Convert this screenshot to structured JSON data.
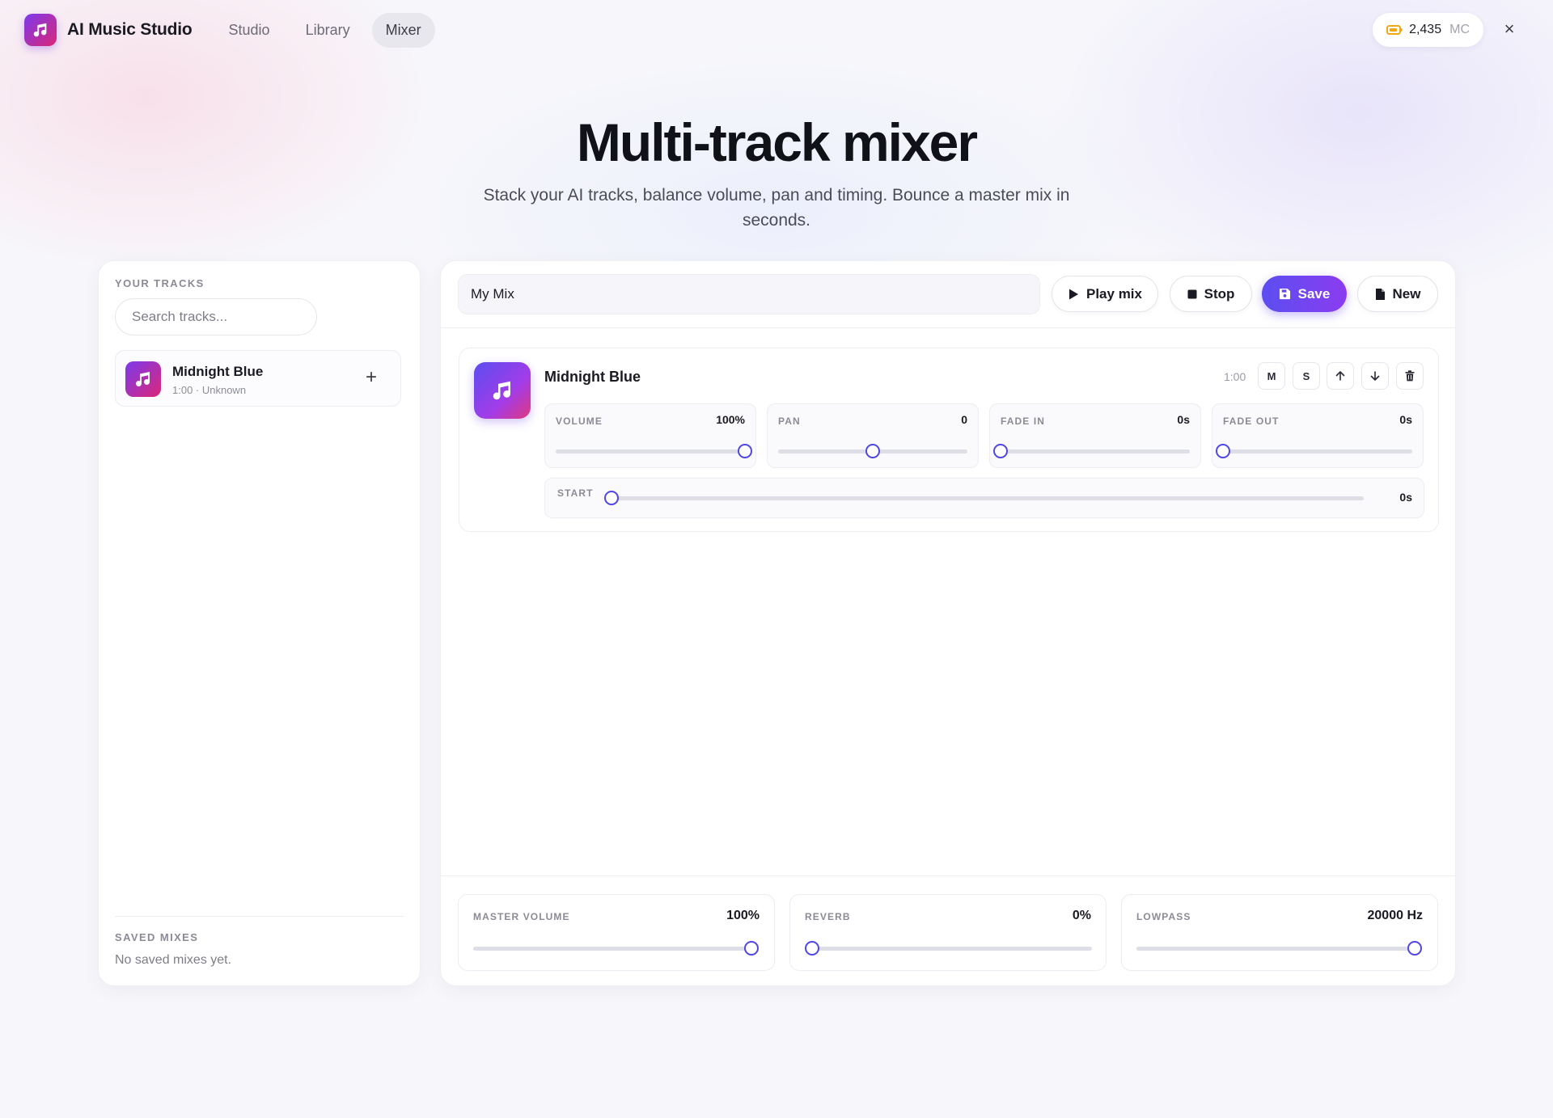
{
  "app": {
    "name": "AI Music Studio"
  },
  "nav": {
    "tabs": [
      "Studio",
      "Library",
      "Mixer"
    ],
    "active": "Mixer"
  },
  "credits": {
    "amount": "2,435",
    "unit": "MC"
  },
  "hero": {
    "title": "Multi-track mixer",
    "subtitle": "Stack your AI tracks, balance volume, pan and timing. Bounce a master mix in seconds."
  },
  "library": {
    "label": "YOUR TRACKS",
    "search_placeholder": "Search tracks...",
    "items": [
      {
        "name": "Midnight Blue",
        "meta": "1:00 · Unknown"
      }
    ],
    "saved_label": "SAVED MIXES",
    "saved_empty": "No saved mixes yet."
  },
  "toolbar": {
    "mix_name": "My Mix",
    "play_label": "Play mix",
    "stop_label": "Stop",
    "save_label": "Save",
    "new_label": "New"
  },
  "track": {
    "name": "Midnight Blue",
    "duration": "1:00",
    "mute_label": "M",
    "solo_label": "S",
    "controls": {
      "volume": {
        "label": "VOLUME",
        "value": "100%",
        "level": 1.0
      },
      "pan": {
        "label": "PAN",
        "value": "0",
        "level": 0.5
      },
      "fade_in": {
        "label": "FADE IN",
        "value": "0s",
        "level": 0.0
      },
      "fade_out": {
        "label": "FADE OUT",
        "value": "0s",
        "level": 0.0
      },
      "start": {
        "label": "START",
        "value": "0s",
        "level": 0.0
      }
    }
  },
  "master": {
    "volume": {
      "label": "MASTER VOLUME",
      "value": "100%",
      "level": 1.0
    },
    "reverb": {
      "label": "REVERB",
      "value": "0%",
      "level": 0.0
    },
    "lowpass": {
      "label": "LOWPASS",
      "value": "20000 Hz",
      "level": 1.0
    }
  },
  "colors": {
    "accent": "#4f46e5",
    "brand_start": "#7c3aed",
    "brand_end": "#db2777",
    "credit_icon": "#f0a818"
  }
}
